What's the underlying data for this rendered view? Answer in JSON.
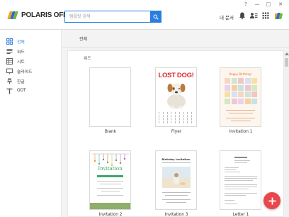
{
  "app": {
    "logo_text": "POLARIS OFFICE",
    "brand_colors": {
      "orange": "#f3a21a",
      "blue": "#2b6cd3",
      "green": "#6cb93c"
    }
  },
  "window_controls": {
    "help": "?",
    "minimize": "—",
    "maximize": "□",
    "close": "✕"
  },
  "search": {
    "placeholder": "템플릿 검색",
    "value": "",
    "button_icon": "search-icon"
  },
  "header": {
    "my_docs_label": "내 문서",
    "icons": [
      "bell-icon",
      "user-group-icon",
      "apps-grid-icon",
      "profile-avatar-icon"
    ]
  },
  "sidebar": {
    "items": [
      {
        "label": "전체",
        "icon": "all-grid-icon",
        "active": true
      },
      {
        "label": "워드",
        "icon": "word-icon",
        "active": false
      },
      {
        "label": "시트",
        "icon": "sheet-icon",
        "active": false
      },
      {
        "label": "슬라이드",
        "icon": "slide-icon",
        "active": false
      },
      {
        "label": "한글",
        "icon": "hangul-icon",
        "active": false
      },
      {
        "label": "ODT",
        "icon": "odt-icon",
        "active": false
      }
    ]
  },
  "main": {
    "breadcrumb": "전체",
    "section_title": "워드",
    "templates": [
      {
        "label": "Blank"
      },
      {
        "label": "Flyer",
        "thumb_title": "LOST DOG!"
      },
      {
        "label": "Invitation 1",
        "thumb_title": "Happy Birthday!"
      },
      {
        "label": "Invitation 2",
        "thumb_title": "Invitation"
      },
      {
        "label": "Invitation 3",
        "thumb_title": "Birthday Invitation"
      },
      {
        "label": "Letter 1"
      }
    ]
  },
  "fab": {
    "icon": "plus-icon"
  },
  "colors": {
    "accent": "#2a7de1",
    "fab": "#e8474b",
    "flyer_red": "#d62a2a"
  }
}
